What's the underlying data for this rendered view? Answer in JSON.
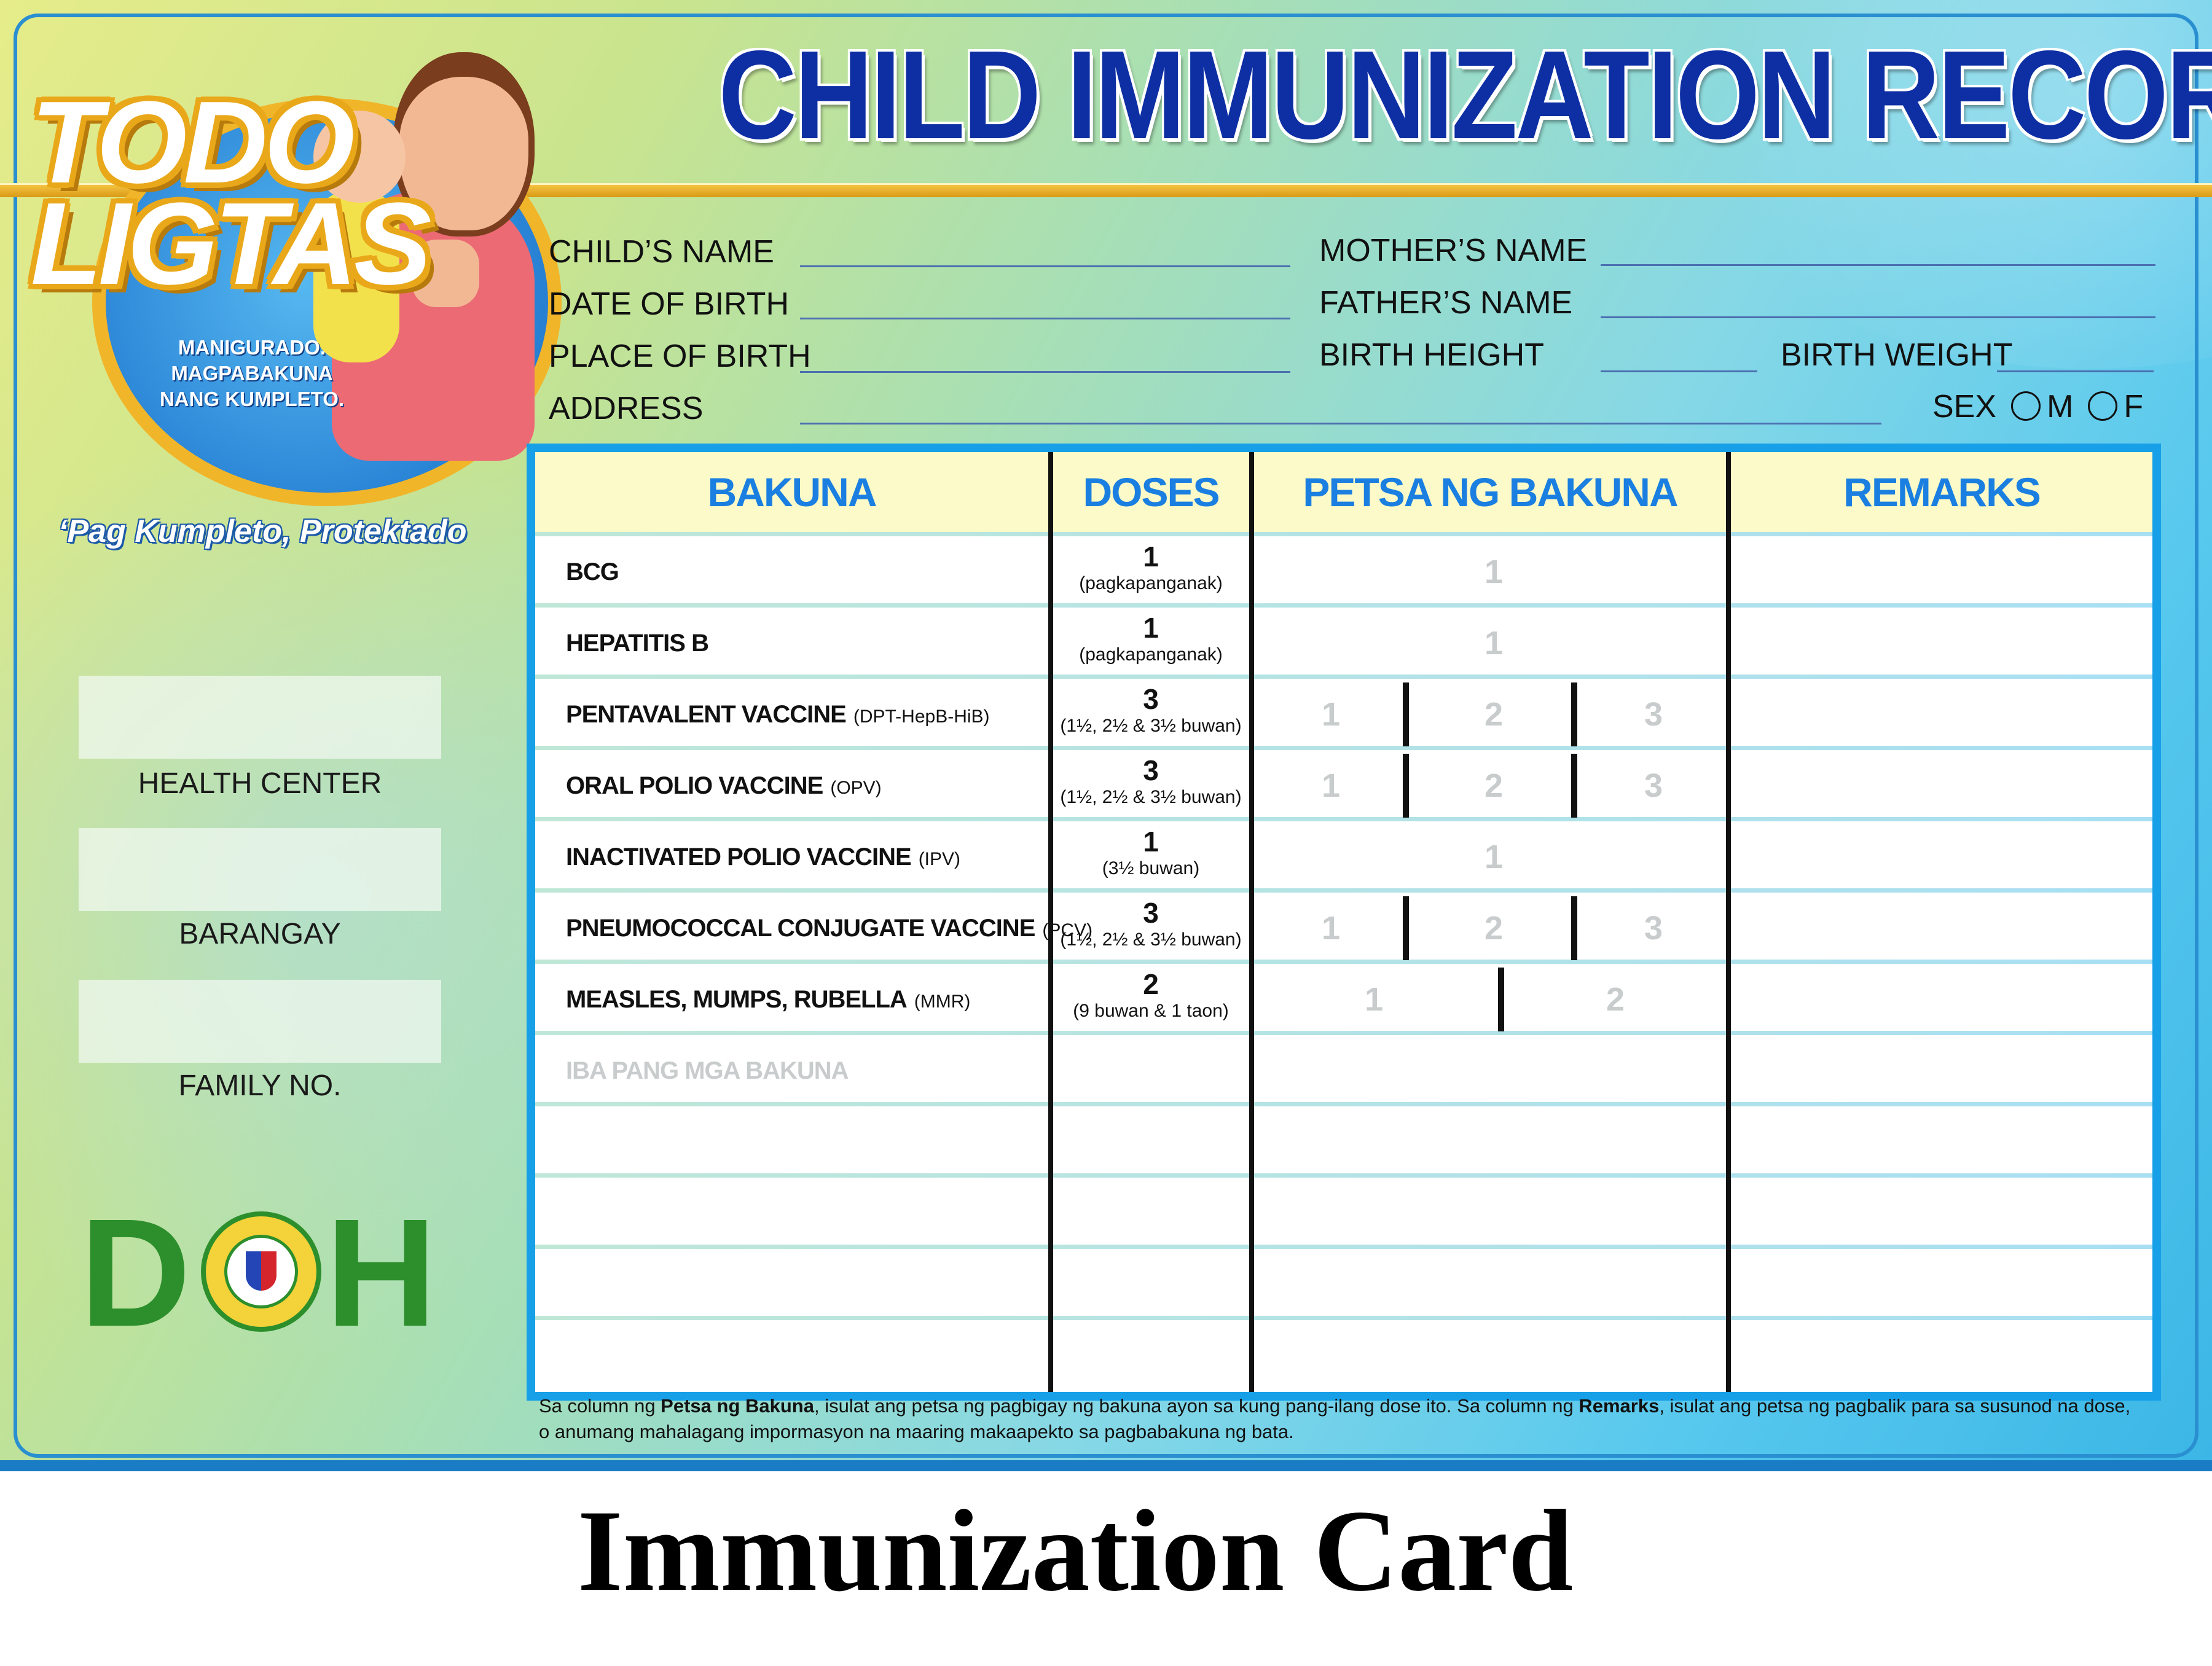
{
  "title": "CHILD IMMUNIZATION RECORD",
  "logo": {
    "wordmark": [
      "TODO",
      "LIGTAS"
    ],
    "tagline": [
      "MANIGURADO.",
      "MAGPABAKUNA",
      "NANG KUMPLETO."
    ],
    "slogan": "‘Pag Kumpleto, Protektado"
  },
  "fields": {
    "childs_name": "CHILD’S NAME",
    "date_of_birth": "DATE OF BIRTH",
    "place_of_birth": "PLACE OF BIRTH",
    "address": "ADDRESS",
    "mothers_name": "MOTHER’S NAME",
    "fathers_name": "FATHER’S NAME",
    "birth_height": "BIRTH HEIGHT",
    "birth_weight": "BIRTH WEIGHT",
    "sex": "SEX",
    "sex_m": "M",
    "sex_f": "F"
  },
  "side": {
    "health_center": "HEALTH CENTER",
    "barangay": "BARANGAY",
    "family_no": "FAMILY NO."
  },
  "doh": {
    "left": "D",
    "right": "H"
  },
  "table": {
    "headers": [
      "BAKUNA",
      "DOSES",
      "PETSA NG BAKUNA",
      "REMARKS"
    ],
    "rows": [
      {
        "name": "BCG",
        "sub": "",
        "doses": "1",
        "detail": "(pagkapanganak)"
      },
      {
        "name": "HEPATITIS B",
        "sub": "",
        "doses": "1",
        "detail": "(pagkapanganak)"
      },
      {
        "name": "PENTAVALENT VACCINE",
        "sub": "(DPT-HepB-HiB)",
        "doses": "3",
        "detail": "(1½, 2½ & 3½ buwan)"
      },
      {
        "name": "ORAL POLIO VACCINE",
        "sub": "(OPV)",
        "doses": "3",
        "detail": "(1½, 2½ & 3½ buwan)"
      },
      {
        "name": "INACTIVATED POLIO VACCINE",
        "sub": "(IPV)",
        "doses": "1",
        "detail": "(3½ buwan)"
      },
      {
        "name": "PNEUMOCOCCAL CONJUGATE VACCINE",
        "sub": "(PCV)",
        "doses": "3",
        "detail": "(1½, 2½ & 3½ buwan)"
      },
      {
        "name": "MEASLES, MUMPS, RUBELLA",
        "sub": "(MMR)",
        "doses": "2",
        "detail": "(9 buwan & 1 taon)"
      }
    ],
    "other_vaccines": "IBA PANG MGA BAKUNA",
    "dose_numbers": [
      "1",
      "2",
      "3"
    ]
  },
  "note": {
    "p1": "Sa column ng ",
    "b1": "Petsa ng Bakuna",
    "p2": ", isulat ang petsa ng pagbigay ng bakuna ayon sa kung pang-ilang dose ito. Sa column ng ",
    "b2": "Remarks",
    "p3": ", isulat ang petsa ng pagbalik para sa susunod na dose, o anumang mahalagang impormasyon na maaring makaapekto sa pagbabakuna ng bata."
  },
  "caption": "Immunization Card",
  "colors": {
    "title": "#0d2fa3",
    "header_text": "#1a7fe0",
    "table_border": "#17a0e8",
    "gold": "#e9a81a",
    "doh_green": "#2c8f2c"
  }
}
